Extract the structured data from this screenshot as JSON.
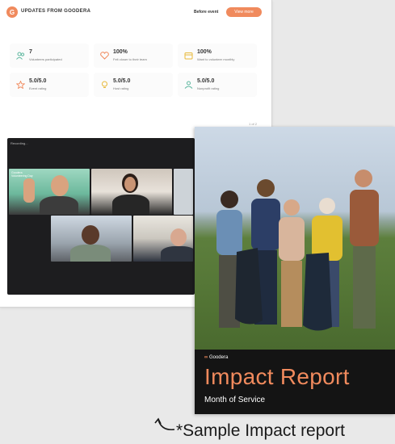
{
  "dashboard": {
    "header": {
      "logo_letter": "G",
      "title": "UPDATES FROM GOODERA",
      "link_label": "Before event",
      "button_label": "View more"
    },
    "stats": [
      {
        "value": "7",
        "label": "Volunteers participated",
        "icon": "people-icon"
      },
      {
        "value": "100%",
        "label": "Felt closer to their team",
        "icon": "heart-icon"
      },
      {
        "value": "100%",
        "label": "Want to volunteer monthly",
        "icon": "calendar-icon"
      },
      {
        "value": "5.0/5.0",
        "label": "Event rating",
        "icon": "star-icon"
      },
      {
        "value": "5.0/5.0",
        "label": "Host rating",
        "icon": "bulb-icon"
      },
      {
        "value": "5.0/5.0",
        "label": "Nonprofit rating",
        "icon": "hands-icon"
      }
    ],
    "page_indicator": "1 of 2"
  },
  "video_call": {
    "recording_label": "Recording...",
    "caption": "Goodera\nVolunteering Day"
  },
  "report": {
    "logo_text": "Goodera",
    "title": "Impact Report",
    "subtitle": "Month of Service"
  },
  "footnote": "*Sample Impact report",
  "colors": {
    "accent": "#f08a5d",
    "report_bg": "#141414"
  }
}
